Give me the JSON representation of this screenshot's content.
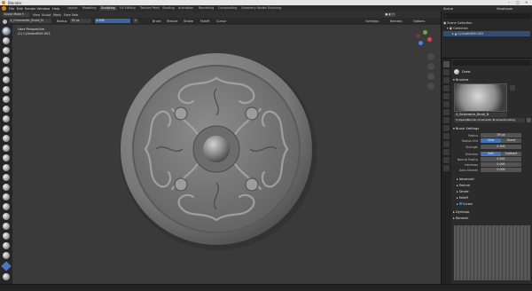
{
  "window": {
    "title": "Blender"
  },
  "menubar": {
    "items": [
      "File",
      "Edit",
      "Render",
      "Window",
      "Help"
    ],
    "workspaces": [
      "Layout",
      "Modeling",
      "Sculpting",
      "UV Editing",
      "Texture Paint",
      "Shading",
      "Animation",
      "Rendering",
      "Compositing",
      "Geometry Nodes",
      "Scripting"
    ],
    "active_workspace": "Sculpting",
    "scene": "Scene",
    "view_layer": "ViewLayer"
  },
  "header": {
    "mode": "Sculpt Mode",
    "menus": [
      "View",
      "Sculpt",
      "Mask",
      "Face Sets"
    ],
    "brush_name": "4_Ornamentic_Brush_N",
    "radius_label": "Radius",
    "radius_value": "39 px",
    "strength_value": "0.300",
    "popovers": [
      "Brush",
      "Texture",
      "Stroke",
      "Falloff",
      "Cursor"
    ],
    "right_items": [
      "Overlays",
      "Remesh",
      "Options"
    ]
  },
  "viewport": {
    "line1": "User Perspective",
    "line2": "(1) CylinderBVH.003"
  },
  "outliner": {
    "search_placeholder": "",
    "rows": [
      "Scene Collection",
      "Collection",
      "CylinderBVH.003"
    ]
  },
  "properties": {
    "tool_name": "Draw",
    "brushes_section": "Brushes",
    "brush_item": "4_Ornamentic_Brush_N",
    "brush_path": "C:\\Users\\Blender Ornamentic Brushes\\Sculpting",
    "brush_settings_section": "Brush Settings",
    "fields": [
      {
        "label": "Radius",
        "value": "39 px"
      },
      {
        "label": "Radius Unit",
        "value": "View",
        "value2": "Scene"
      },
      {
        "label": "Strength",
        "value": "0.300"
      },
      {
        "label": "Direction",
        "value": "Add",
        "value2": "Subtract"
      },
      {
        "label": "Normal Radius",
        "value": "0.500"
      },
      {
        "label": "Hardness",
        "value": "0.000"
      },
      {
        "label": "Auto-Smooth",
        "value": "0.000"
      }
    ],
    "subsections": [
      "Advanced",
      "Texture",
      "Stroke",
      "Falloff",
      "Cursor"
    ],
    "lower_sections": [
      "Dyntopo",
      "Remesh"
    ]
  },
  "colors": {
    "accent": "#4772b3",
    "viewport_bg": "#3a3a3a",
    "panel_bg": "#2b2b2b"
  }
}
